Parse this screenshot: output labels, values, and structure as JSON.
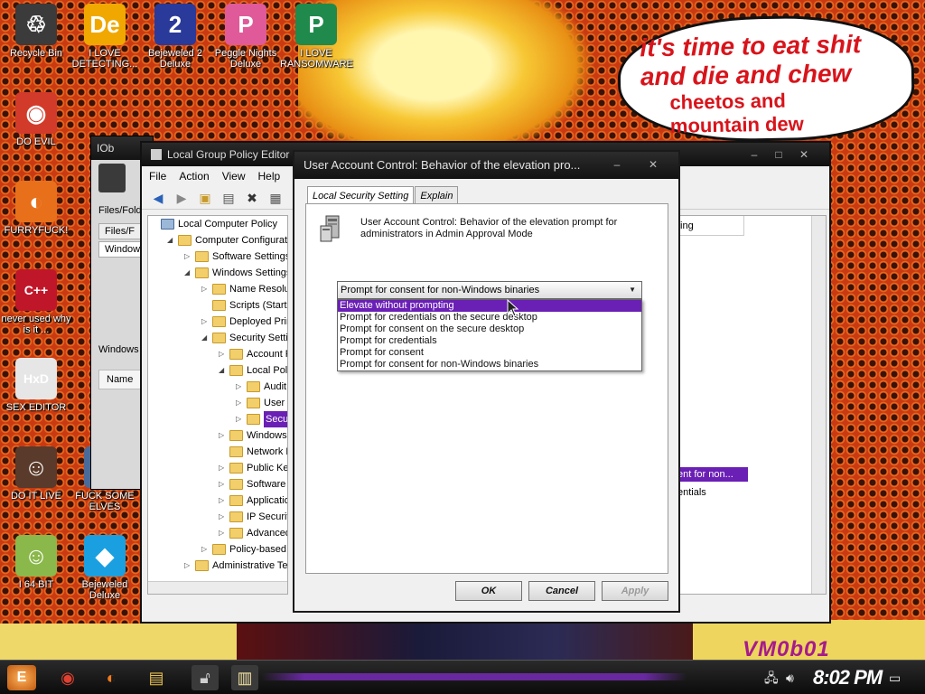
{
  "desktop": {
    "bubble_line1": "it's time to eat shit",
    "bubble_line2": "and die and chew",
    "bubble_line3": "cheetos and",
    "bubble_line4": "mountain dew",
    "watermark": "VM0b01",
    "icons": [
      {
        "name": "recycle-bin-icon",
        "label": "Recycle Bin",
        "glyph": "♲",
        "color": "#3b3b3b"
      },
      {
        "name": "i-love-detecting-icon",
        "label": "I LOVE DETECTING...",
        "glyph": "De",
        "color": "#f0a800"
      },
      {
        "name": "bejeweled2-icon",
        "label": "Bejeweled 2 Deluxe",
        "glyph": "2",
        "color": "#2a3a9a"
      },
      {
        "name": "peggle-icon",
        "label": "Peggle Nights Deluxe",
        "glyph": "P",
        "color": "#e05a9a"
      },
      {
        "name": "ransomware-icon",
        "label": "I LOVE RANSOMWARE",
        "glyph": "P",
        "color": "#1f8a4c"
      },
      {
        "name": "chrome-icon",
        "label": "DO EVIL",
        "glyph": "◉",
        "color": "#d23a2a"
      },
      {
        "name": "firefox-icon",
        "label": "FURRYFUCK!",
        "glyph": "◐",
        "color": "#e8701a"
      },
      {
        "name": "devcpp-icon",
        "label": "never used why is it ...",
        "glyph": "C++",
        "color": "#c0162a"
      },
      {
        "name": "hxd-icon",
        "label": "SEX EDITOR",
        "glyph": "HxD",
        "color": "#e6e6e6"
      },
      {
        "name": "portrait-icon",
        "label": "DO IT LIVE",
        "glyph": "☺",
        "color": "#5a3a2a"
      },
      {
        "name": "elves-icon",
        "label": "FUCK SOME ELVES",
        "glyph": "☺",
        "color": "#4a6a9a"
      },
      {
        "name": "win64-icon",
        "label": "I 64 BIT",
        "glyph": "☺",
        "color": "#8ab84a"
      },
      {
        "name": "bejeweled-icon",
        "label": "Bejeweled Deluxe",
        "glyph": "◆",
        "color": "#1aa0e0"
      }
    ]
  },
  "background_window": {
    "title": "IOb",
    "label1": "Files/Fold",
    "label2": "Files/F",
    "label3": "Window",
    "label4": "Windows",
    "label5": "Name"
  },
  "gpe": {
    "title": "Local Group Policy Editor",
    "menu": [
      "File",
      "Action",
      "View",
      "Help"
    ],
    "tree": [
      {
        "label": "Local Computer Policy",
        "level": 0,
        "exp": ""
      },
      {
        "label": "Computer Configuration",
        "level": 1,
        "exp": "◢"
      },
      {
        "label": "Software Settings",
        "level": 2,
        "exp": "▷"
      },
      {
        "label": "Windows Settings",
        "level": 2,
        "exp": "◢"
      },
      {
        "label": "Name Resolution Policy",
        "level": 3,
        "exp": "▷"
      },
      {
        "label": "Scripts (Startup/Shutdown)",
        "level": 3,
        "exp": ""
      },
      {
        "label": "Deployed Printers",
        "level": 3,
        "exp": "▷"
      },
      {
        "label": "Security Settings",
        "level": 3,
        "exp": "◢"
      },
      {
        "label": "Account Policies",
        "level": 4,
        "exp": "▷"
      },
      {
        "label": "Local Policies",
        "level": 4,
        "exp": "◢"
      },
      {
        "label": "Audit Policy",
        "level": 5,
        "exp": "▷"
      },
      {
        "label": "User Rights Assignment",
        "level": 5,
        "exp": "▷"
      },
      {
        "label": "Security Options",
        "level": 5,
        "exp": "▷",
        "selected": true
      },
      {
        "label": "Windows Firewall",
        "level": 4,
        "exp": "▷"
      },
      {
        "label": "Network List Manager",
        "level": 4,
        "exp": ""
      },
      {
        "label": "Public Key Policies",
        "level": 4,
        "exp": "▷"
      },
      {
        "label": "Software Restriction",
        "level": 4,
        "exp": "▷"
      },
      {
        "label": "Application Control",
        "level": 4,
        "exp": "▷"
      },
      {
        "label": "IP Security Policies",
        "level": 4,
        "exp": "▷"
      },
      {
        "label": "Advanced Audit",
        "level": 4,
        "exp": "▷"
      },
      {
        "label": "Policy-based QoS",
        "level": 3,
        "exp": "▷"
      },
      {
        "label": "Administrative Templates",
        "level": 2,
        "exp": "▷"
      }
    ],
    "right_header": "ting",
    "right_selected": "ent for non...",
    "right_plain": "entials"
  },
  "dialog": {
    "title": "User Account Control: Behavior of the elevation pro...",
    "tab_setting": "Local Security Setting",
    "tab_explain": "Explain",
    "policy_text": "User Account Control: Behavior of the elevation prompt for administrators in Admin Approval Mode",
    "combo_value": "Prompt for consent for non-Windows binaries",
    "options": [
      "Elevate without prompting",
      "Prompt for credentials on the secure desktop",
      "Prompt for consent on the secure desktop",
      "Prompt for credentials",
      "Prompt for consent",
      "Prompt for consent for non-Windows binaries"
    ],
    "highlighted_option": 0,
    "ok": "OK",
    "cancel": "Cancel",
    "apply": "Apply"
  },
  "taskbar": {
    "clock": "8:02 PM",
    "start_glyph": "E"
  }
}
